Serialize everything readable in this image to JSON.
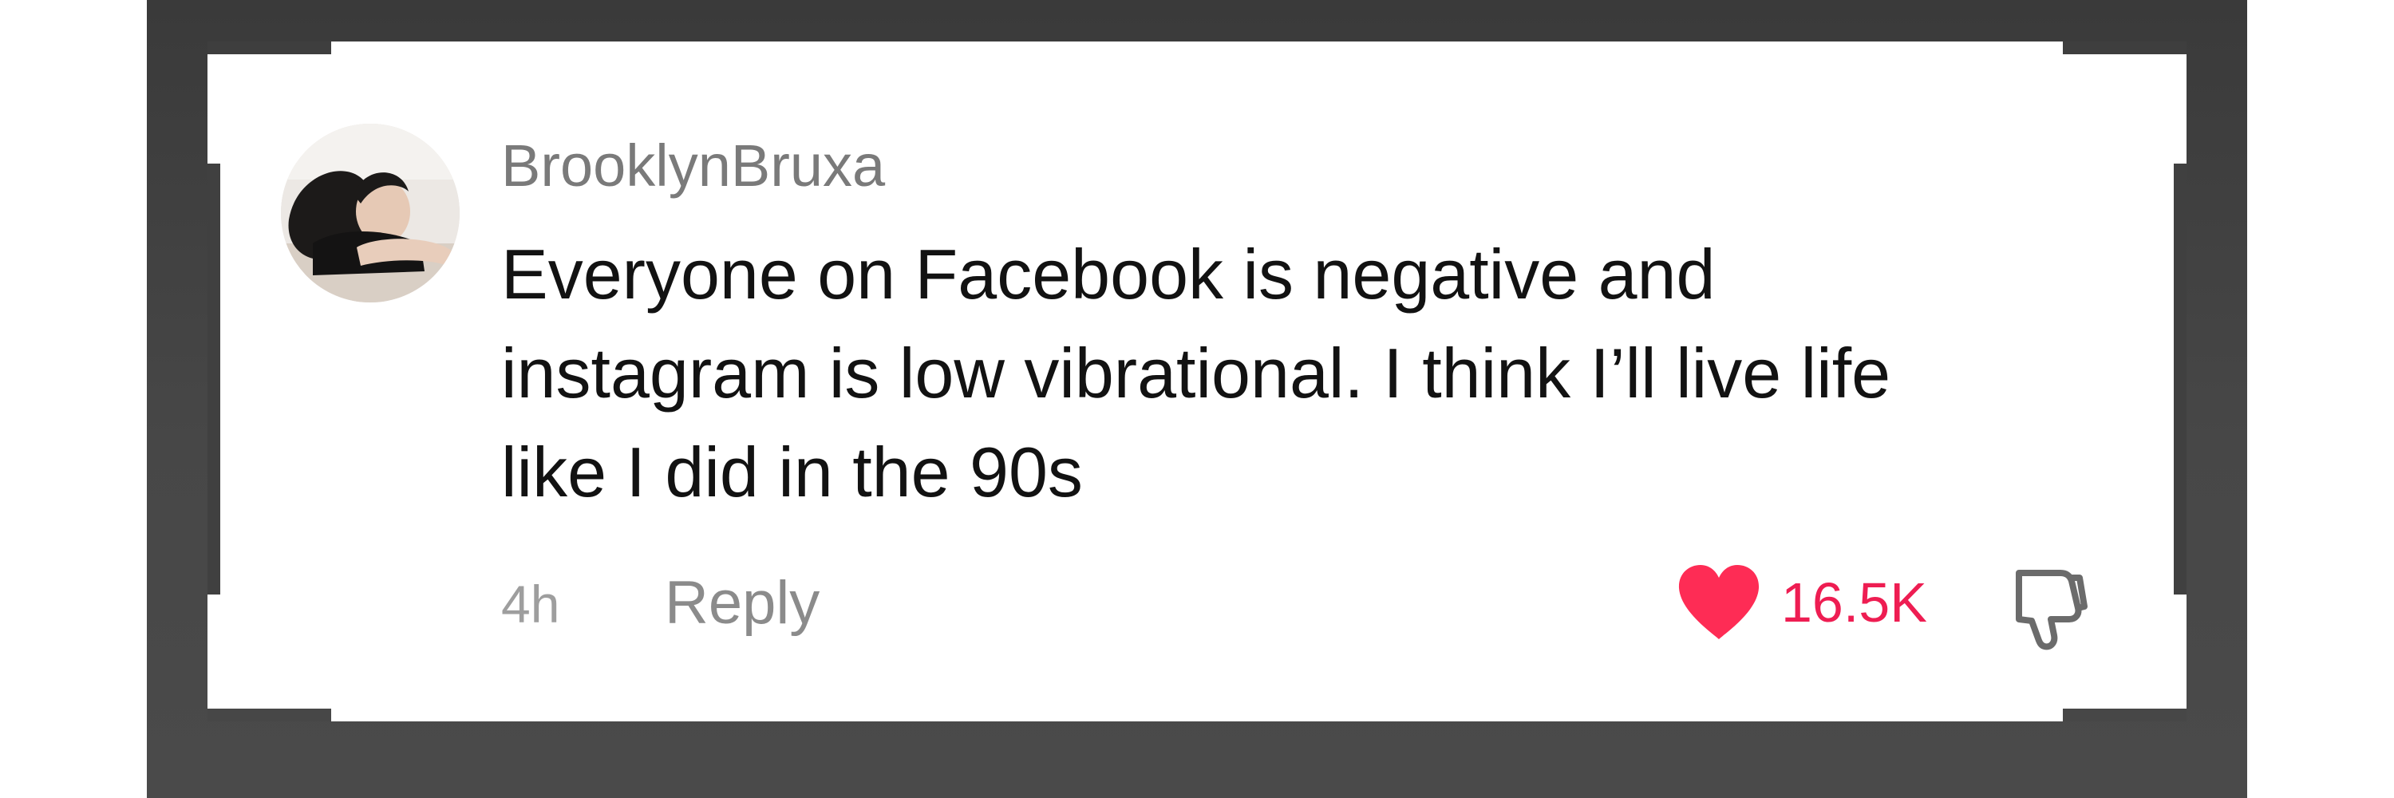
{
  "comment": {
    "author": "BrooklynBruxa",
    "text_lines": [
      "Everyone on Facebook is negative and",
      "instagram is low vibrational. I think I’ll live life",
      "like I did in the 90s"
    ],
    "time": "4h",
    "reply_label": "Reply",
    "like_count": "16.5K"
  },
  "icons": {
    "like": "heart-icon",
    "dislike": "thumbs-down-icon",
    "avatar": "user-avatar"
  },
  "colors": {
    "like": "#ee1d52",
    "username": "#7a7a7a",
    "text": "#121212",
    "meta": "#9e9e9e",
    "backdrop": "#434343"
  }
}
